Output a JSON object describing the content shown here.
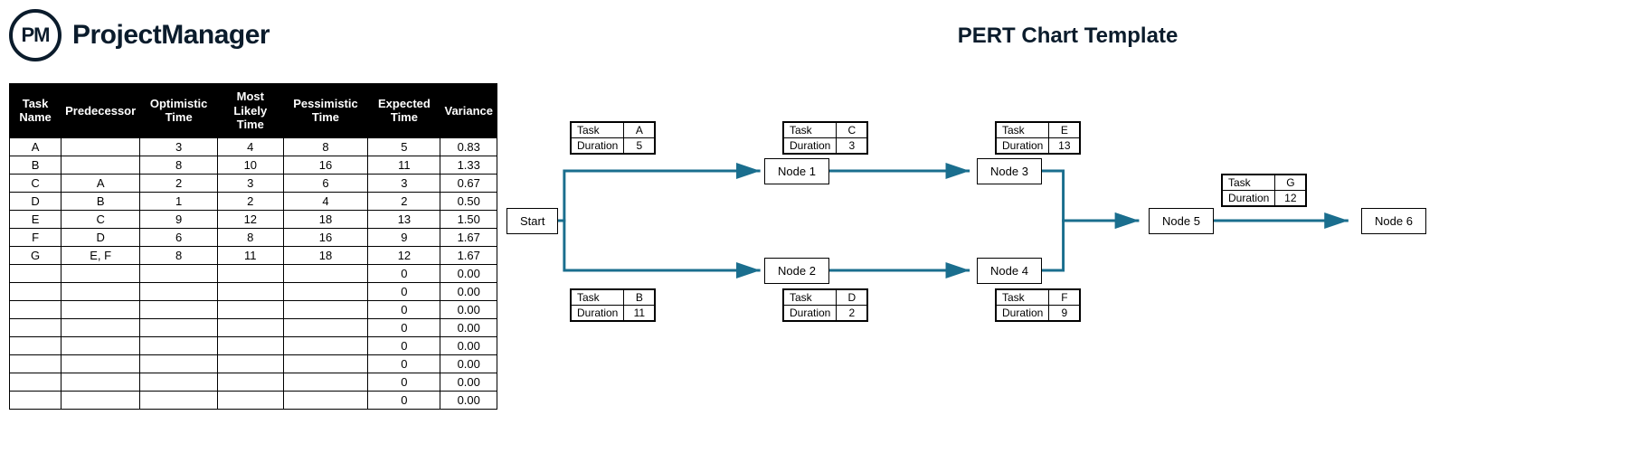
{
  "logo": {
    "badge": "PM",
    "text": "ProjectManager"
  },
  "title": "PERT Chart Template",
  "table": {
    "headers": [
      "Task Name",
      "Predecessor",
      "Optimistic Time",
      "Most Likely Time",
      "Pessimistic Time",
      "Expected Time",
      "Variance"
    ],
    "rows": [
      {
        "task": "A",
        "pred": "",
        "opt": "3",
        "ml": "4",
        "pes": "8",
        "exp": "5",
        "var": "0.83"
      },
      {
        "task": "B",
        "pred": "",
        "opt": "8",
        "ml": "10",
        "pes": "16",
        "exp": "11",
        "var": "1.33"
      },
      {
        "task": "C",
        "pred": "A",
        "opt": "2",
        "ml": "3",
        "pes": "6",
        "exp": "3",
        "var": "0.67"
      },
      {
        "task": "D",
        "pred": "B",
        "opt": "1",
        "ml": "2",
        "pes": "4",
        "exp": "2",
        "var": "0.50"
      },
      {
        "task": "E",
        "pred": "C",
        "opt": "9",
        "ml": "12",
        "pes": "18",
        "exp": "13",
        "var": "1.50"
      },
      {
        "task": "F",
        "pred": "D",
        "opt": "6",
        "ml": "8",
        "pes": "16",
        "exp": "9",
        "var": "1.67"
      },
      {
        "task": "G",
        "pred": "E, F",
        "opt": "8",
        "ml": "11",
        "pes": "18",
        "exp": "12",
        "var": "1.67"
      },
      {
        "task": "",
        "pred": "",
        "opt": "",
        "ml": "",
        "pes": "",
        "exp": "0",
        "var": "0.00"
      },
      {
        "task": "",
        "pred": "",
        "opt": "",
        "ml": "",
        "pes": "",
        "exp": "0",
        "var": "0.00"
      },
      {
        "task": "",
        "pred": "",
        "opt": "",
        "ml": "",
        "pes": "",
        "exp": "0",
        "var": "0.00"
      },
      {
        "task": "",
        "pred": "",
        "opt": "",
        "ml": "",
        "pes": "",
        "exp": "0",
        "var": "0.00"
      },
      {
        "task": "",
        "pred": "",
        "opt": "",
        "ml": "",
        "pes": "",
        "exp": "0",
        "var": "0.00"
      },
      {
        "task": "",
        "pred": "",
        "opt": "",
        "ml": "",
        "pes": "",
        "exp": "0",
        "var": "0.00"
      },
      {
        "task": "",
        "pred": "",
        "opt": "",
        "ml": "",
        "pes": "",
        "exp": "0",
        "var": "0.00"
      },
      {
        "task": "",
        "pred": "",
        "opt": "",
        "ml": "",
        "pes": "",
        "exp": "0",
        "var": "0.00"
      }
    ]
  },
  "diagram": {
    "labels": {
      "task": "Task",
      "duration": "Duration",
      "start": "Start",
      "node1": "Node 1",
      "node2": "Node 2",
      "node3": "Node 3",
      "node4": "Node 4",
      "node5": "Node 5",
      "node6": "Node 6"
    },
    "tasks": {
      "A": {
        "name": "A",
        "duration": "5"
      },
      "B": {
        "name": "B",
        "duration": "11"
      },
      "C": {
        "name": "C",
        "duration": "3"
      },
      "D": {
        "name": "D",
        "duration": "2"
      },
      "E": {
        "name": "E",
        "duration": "13"
      },
      "F": {
        "name": "F",
        "duration": "9"
      },
      "G": {
        "name": "G",
        "duration": "12"
      }
    }
  },
  "chart_data": {
    "type": "table",
    "title": "PERT Chart Template",
    "columns": [
      "Task Name",
      "Predecessor",
      "Optimistic Time",
      "Most Likely Time",
      "Pessimistic Time",
      "Expected Time",
      "Variance"
    ],
    "rows": [
      [
        "A",
        "",
        3,
        4,
        8,
        5,
        0.83
      ],
      [
        "B",
        "",
        8,
        10,
        16,
        11,
        1.33
      ],
      [
        "C",
        "A",
        2,
        3,
        6,
        3,
        0.67
      ],
      [
        "D",
        "B",
        1,
        2,
        4,
        2,
        0.5
      ],
      [
        "E",
        "C",
        9,
        12,
        18,
        13,
        1.5
      ],
      [
        "F",
        "D",
        6,
        8,
        16,
        9,
        1.67
      ],
      [
        "G",
        "E, F",
        8,
        11,
        18,
        12,
        1.67
      ]
    ],
    "network": {
      "nodes": [
        "Start",
        "Node 1",
        "Node 2",
        "Node 3",
        "Node 4",
        "Node 5",
        "Node 6"
      ],
      "edges": [
        {
          "from": "Start",
          "to": "Node 1",
          "task": "A",
          "duration": 5
        },
        {
          "from": "Start",
          "to": "Node 2",
          "task": "B",
          "duration": 11
        },
        {
          "from": "Node 1",
          "to": "Node 3",
          "task": "C",
          "duration": 3
        },
        {
          "from": "Node 2",
          "to": "Node 4",
          "task": "D",
          "duration": 2
        },
        {
          "from": "Node 3",
          "to": "Node 5",
          "task": "E",
          "duration": 13
        },
        {
          "from": "Node 4",
          "to": "Node 5",
          "task": "F",
          "duration": 9
        },
        {
          "from": "Node 5",
          "to": "Node 6",
          "task": "G",
          "duration": 12
        }
      ]
    }
  }
}
